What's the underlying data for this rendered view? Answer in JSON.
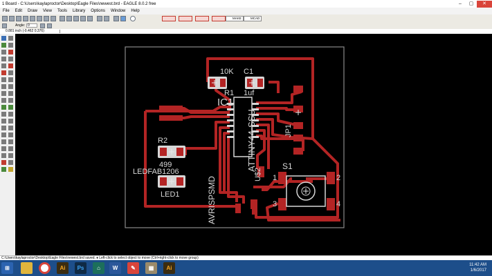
{
  "window": {
    "title": "1 Board - C:\\Users\\kaylaproctor\\Desktop\\Eagle Files\\newest.brd - EAGLE 8.0.2 free"
  },
  "menu": [
    {
      "label": "File"
    },
    {
      "label": "Edit"
    },
    {
      "label": "Draw"
    },
    {
      "label": "View"
    },
    {
      "label": "Tools"
    },
    {
      "label": "Library"
    },
    {
      "label": "Options"
    },
    {
      "label": "Window"
    },
    {
      "label": "Help"
    }
  ],
  "toolbar": {
    "make_label": "MAKE",
    "mcad_label": "MCAD"
  },
  "params": {
    "angle_label": "Angle:",
    "angle_value": "0"
  },
  "coordinates": "0.881 inch (-0.462 0.376)",
  "board": {
    "trace_color": "#b32424",
    "labels": {
      "r1_value": "10K",
      "r1_name": "R1",
      "c1_name": "C1",
      "c1_value": "1uf",
      "ic1_name": "IC1",
      "ic1_part": "ATTINY44-SSU",
      "jp1_name": "JP1",
      "r2_name": "R2",
      "r2_value": "499",
      "led_part": "LEDFAB1206",
      "led_name": "LED1",
      "u2_name": "U$2",
      "avr_part": "AVRISPSMD",
      "s1_name": "S1",
      "s1_pin1": "1",
      "s1_pin2": "2",
      "s1_pin3": "3",
      "s1_pin4": "4"
    }
  },
  "status": {
    "text": "C:\\Users\\kaylaproctor\\Desktop\\Eagle Files\\newest.brd saved.  ♦ Left-click to select object to move (Ctrl+right-click to move group)"
  },
  "taskbar": {
    "clock_time": "11:42 AM",
    "clock_date": "1/6/2017"
  }
}
